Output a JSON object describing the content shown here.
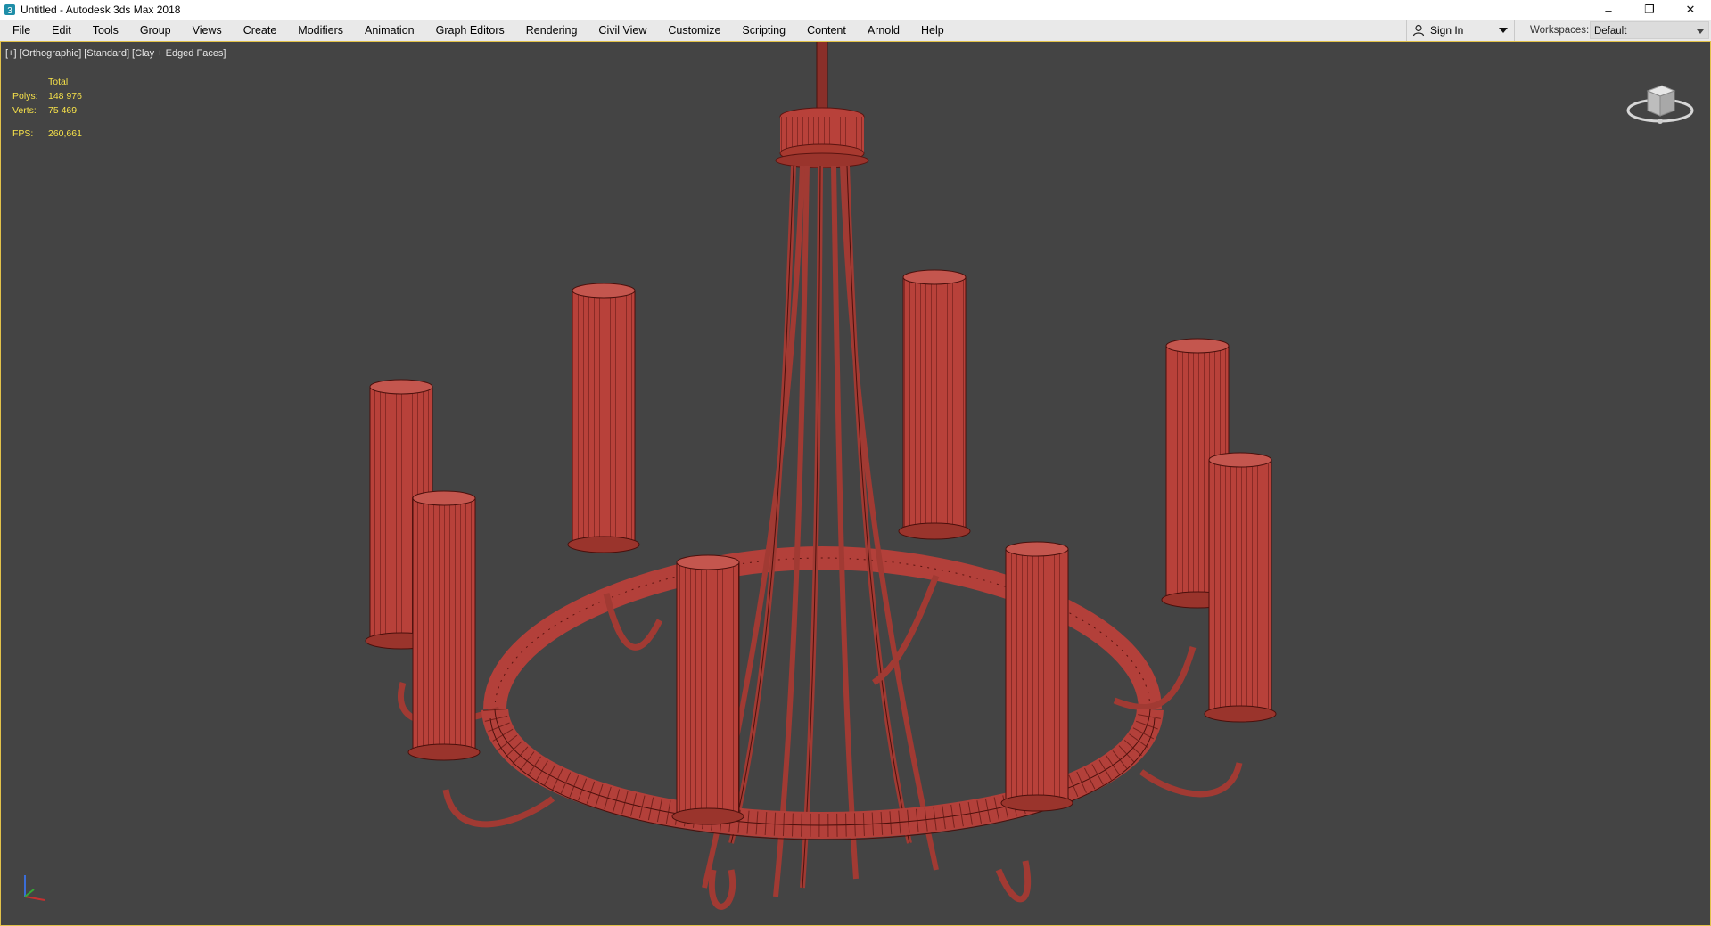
{
  "window": {
    "title": "Untitled - Autodesk 3ds Max 2018",
    "app_icon": "3ds-max-logo-icon",
    "controls": {
      "minimize": "–",
      "restore": "❐",
      "close": "✕"
    }
  },
  "menu": {
    "items": [
      "File",
      "Edit",
      "Tools",
      "Group",
      "Views",
      "Create",
      "Modifiers",
      "Animation",
      "Graph Editors",
      "Rendering",
      "Civil View",
      "Customize",
      "Scripting",
      "Content",
      "Arnold",
      "Help"
    ],
    "sign_in": "Sign In",
    "workspaces_label": "Workspaces:",
    "workspace_value": "Default"
  },
  "viewport": {
    "labels": [
      "[+]",
      "[Orthographic]",
      "[Standard]",
      "[Clay + Edged Faces]"
    ],
    "stats": {
      "header": "Total",
      "polys_label": "Polys:",
      "polys_value": "148 976",
      "verts_label": "Verts:",
      "verts_value": "75 469",
      "fps_label": "FPS:",
      "fps_value": "260,661"
    },
    "colors": {
      "background": "#444444",
      "mesh_fill": "#b8413a",
      "wire": "#5a1410",
      "stats_text": "#f5e04a",
      "active_border": "#e2c24a"
    },
    "model": "chandelier-wireframe-model"
  }
}
